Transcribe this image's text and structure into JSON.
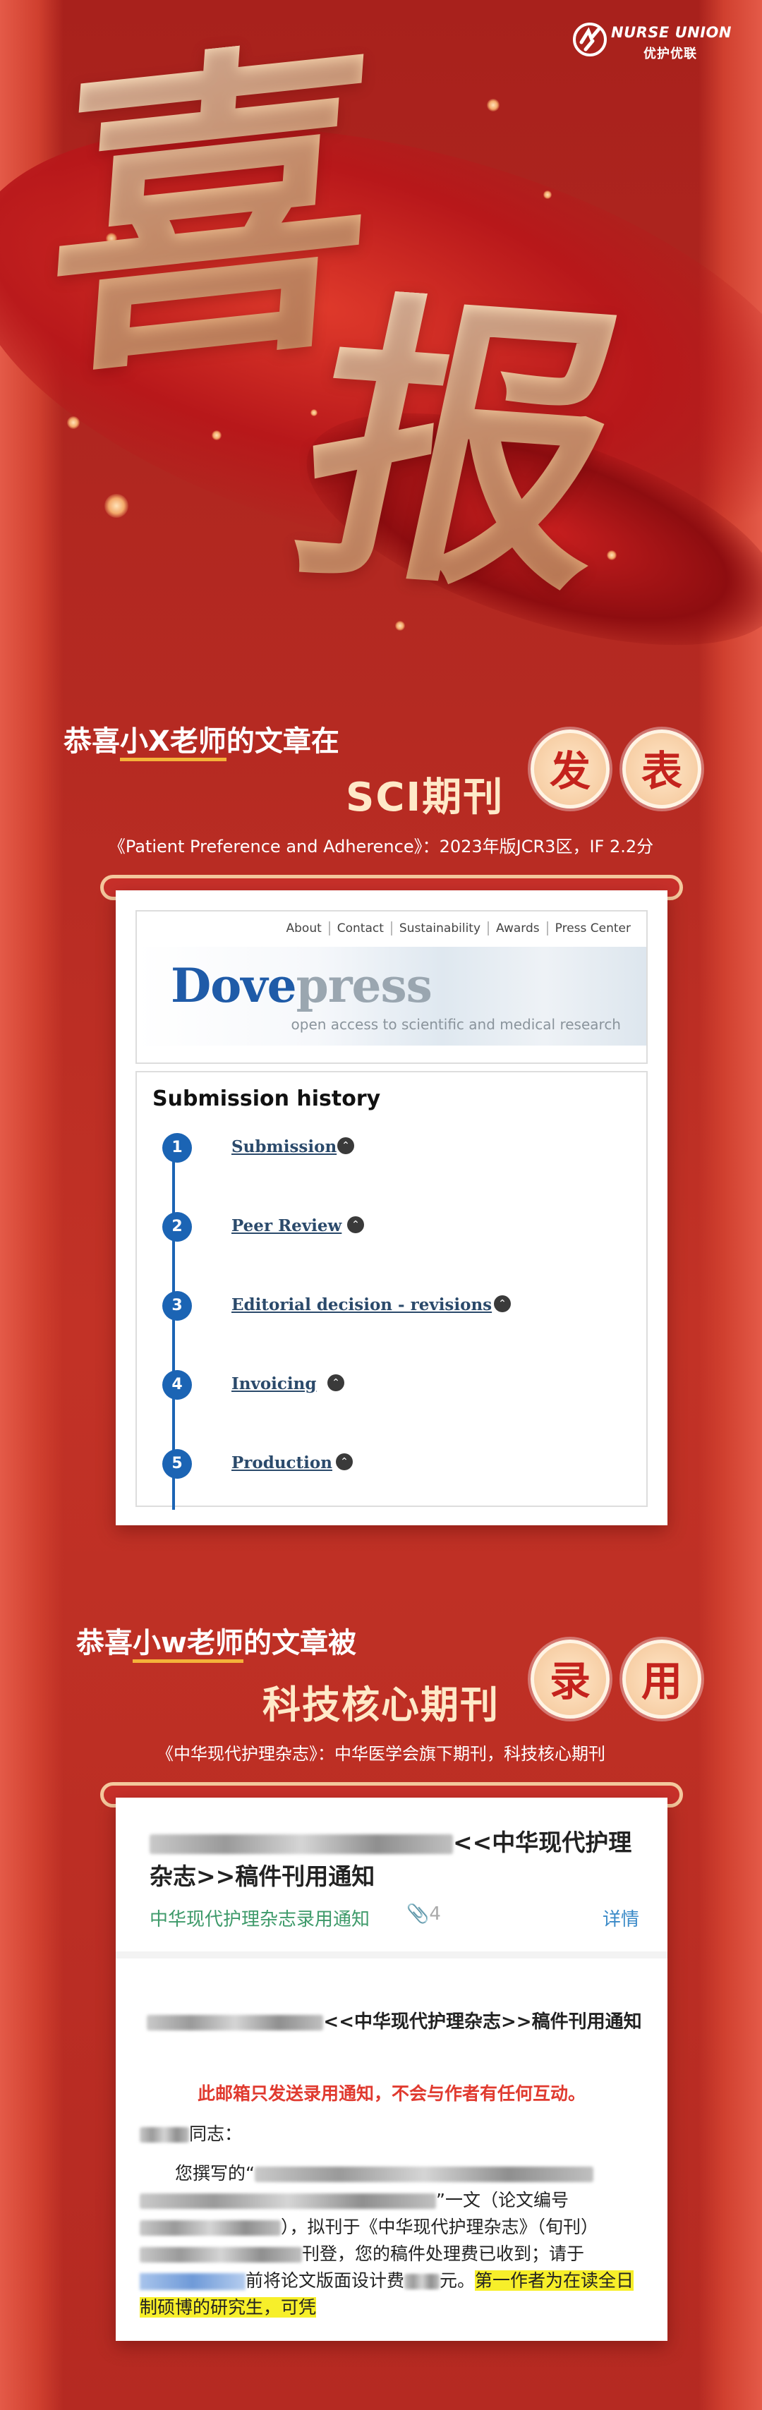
{
  "brand": {
    "name_en": "NURSE UNION",
    "name_cn": "优护优联"
  },
  "hero": {
    "char1": "喜",
    "char2": "报"
  },
  "section1": {
    "headline_pre": "恭喜",
    "headline_name": "小X老师",
    "headline_post": "的文章在",
    "journal_type": "SCI期刊",
    "badge1": "发",
    "badge2": "表",
    "subtitle": "《Patient Preference and Adherence》：2023年版JCR3区，IF 2.2分"
  },
  "dovepress": {
    "nav": [
      "About",
      "Contact",
      "Sustainability",
      "Awards",
      "Press Center"
    ],
    "logo_a": "Dove",
    "logo_b": "press",
    "tagline": "open access to scientific and medical research",
    "history_title": "Submission history",
    "steps": [
      {
        "num": "1",
        "label": "Submission"
      },
      {
        "num": "2",
        "label": "Peer Review"
      },
      {
        "num": "3",
        "label": "Editorial decision - revisions"
      },
      {
        "num": "4",
        "label": "Invoicing"
      },
      {
        "num": "5",
        "label": "Production"
      }
    ],
    "chevron": "⌃"
  },
  "section2": {
    "headline_pre": "恭喜",
    "headline_name": "小w老师",
    "headline_post": "的文章被",
    "journal_type": "科技核心期刊",
    "badge1": "录",
    "badge2": "用",
    "subtitle": "《中华现代护理杂志》：中华医学会旗下期刊，科技核心期刊"
  },
  "notice": {
    "title_end": "<<中华现代护理杂志>>稿件刊用通知",
    "subject": "中华现代护理杂志录用通知",
    "attachments": "4",
    "detail_link": "详情",
    "heading_end": "<<中华现代护理杂志>>稿件刊用通知",
    "warning": "此邮箱只发送录用通知，不会与作者有任何互动。",
    "greeting": "同志：",
    "para1_a": "您撰写的“",
    "para1_b": "”一文（论文编号",
    "para1_c": "），拟刊于《中华现代护理杂志》（旬刊）",
    "para1_d": "刊登，您的稿件处理费已收到；请于",
    "para1_e": "前将论文版面设计费",
    "para1_f": "元。",
    "highlight": "第一作者为在读全日制硕博的研究生，可凭"
  }
}
